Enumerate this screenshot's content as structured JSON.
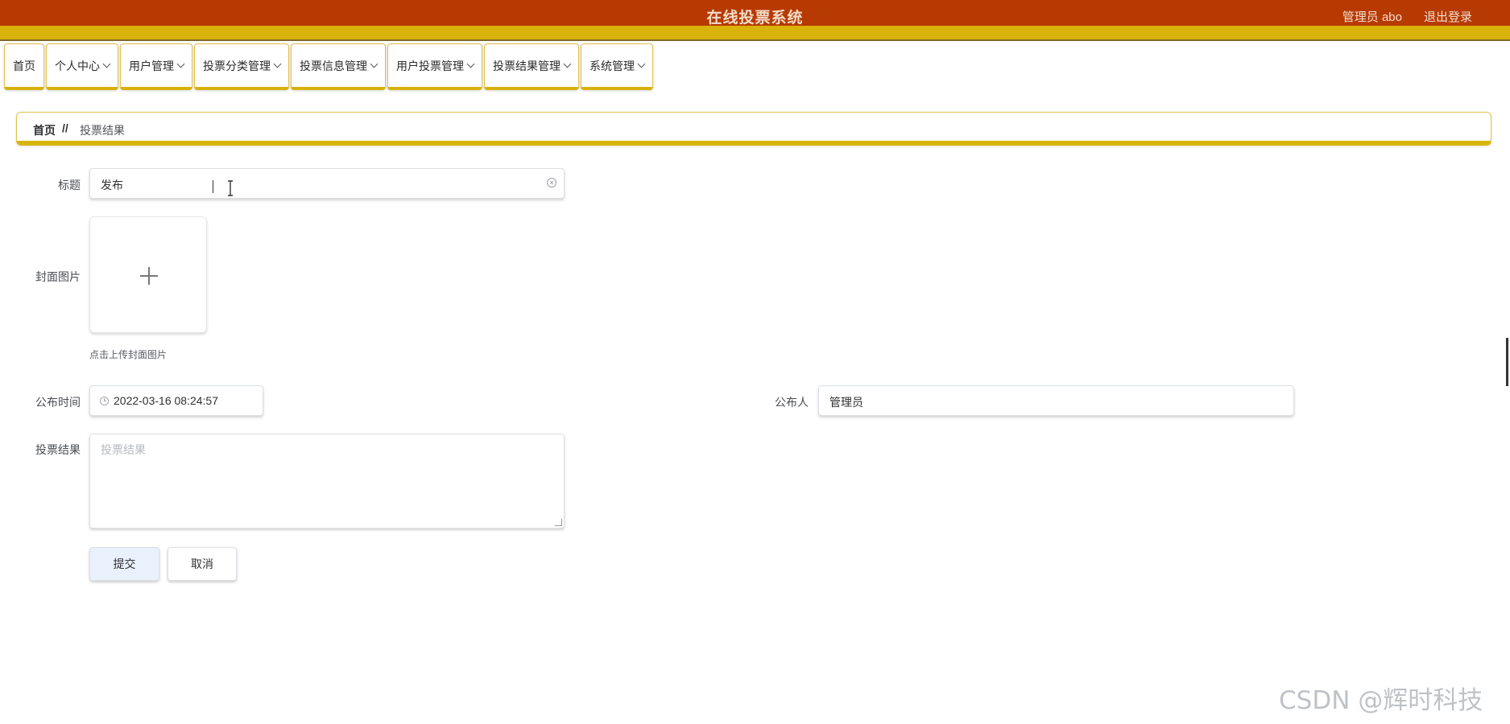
{
  "header": {
    "title": "在线投票系统",
    "user": "管理员 abo",
    "logout": "退出登录"
  },
  "nav": {
    "items": [
      {
        "label": "首页",
        "dropdown": false
      },
      {
        "label": "个人中心",
        "dropdown": true
      },
      {
        "label": "用户管理",
        "dropdown": true
      },
      {
        "label": "投票分类管理",
        "dropdown": true
      },
      {
        "label": "投票信息管理",
        "dropdown": true
      },
      {
        "label": "用户投票管理",
        "dropdown": true
      },
      {
        "label": "投票结果管理",
        "dropdown": true
      },
      {
        "label": "系统管理",
        "dropdown": true
      }
    ]
  },
  "breadcrumb": {
    "home": "首页",
    "separator": "//",
    "current": "投票结果"
  },
  "form": {
    "title_label": "标题",
    "title_value": "发布",
    "cover_label": "封面图片",
    "cover_tip": "点击上传封面图片",
    "publish_time_label": "公布时间",
    "publish_time_value": "2022-03-16 08:24:57",
    "publisher_label": "公布人",
    "publisher_value": "管理员",
    "result_label": "投票结果",
    "result_placeholder": "投票结果",
    "submit": "提交",
    "cancel": "取消"
  },
  "watermark": "CSDN @辉时科技",
  "colors": {
    "header_bg": "#b73a02",
    "accent_gold": "#d9b20c",
    "submit_bg": "#e9f1fc"
  }
}
